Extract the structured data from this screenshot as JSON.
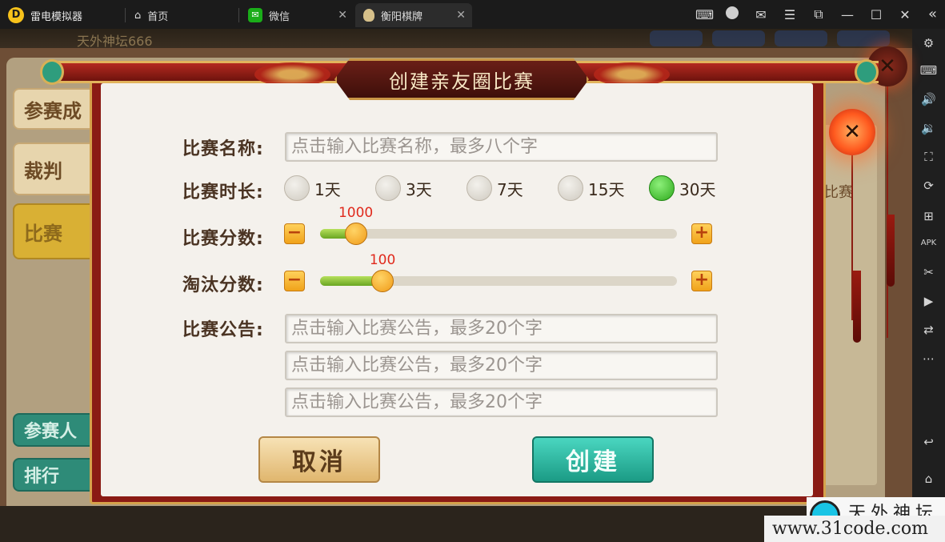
{
  "titlebar": {
    "app_name": "雷电模拟器",
    "tabs": [
      {
        "label": "首页"
      },
      {
        "label": "微信"
      },
      {
        "label": "衡阳棋牌"
      }
    ]
  },
  "game_bg": {
    "top_name": "天外神坛666",
    "left_buttons": [
      "参赛成",
      "裁判",
      "比赛",
      "参赛人",
      "排行"
    ],
    "right_tab": "比赛"
  },
  "dialog": {
    "title": "创建亲友圈比赛",
    "name_label": "比赛名称:",
    "name_placeholder": "点击输入比赛名称，最多八个字",
    "duration_label": "比赛时长:",
    "duration_options": [
      {
        "label": "1天",
        "selected": false
      },
      {
        "label": "3天",
        "selected": false
      },
      {
        "label": "7天",
        "selected": false
      },
      {
        "label": "15天",
        "selected": false
      },
      {
        "label": "30天",
        "selected": true
      }
    ],
    "score_label": "比赛分数:",
    "score_value": "1000",
    "score_fraction": 0.1,
    "elim_label": "淘汰分数:",
    "elim_value": "100",
    "elim_fraction": 0.175,
    "notice_label": "比赛公告:",
    "notice_placeholders": [
      "点击输入比赛公告，最多20个字",
      "点击输入比赛公告，最多20个字",
      "点击输入比赛公告，最多20个字"
    ],
    "cancel_label": "取消",
    "create_label": "创建"
  },
  "watermark": {
    "site": "www.31code.com",
    "brand": "天外神坛"
  },
  "colors": {
    "selected_radio": "#2ea91c",
    "slider_fill": "#6aa622",
    "slider_value": "#e0291c",
    "create_button": "#1b9b85",
    "cancel_button": "#e0b66e",
    "frame_red": "#8a1b14"
  }
}
